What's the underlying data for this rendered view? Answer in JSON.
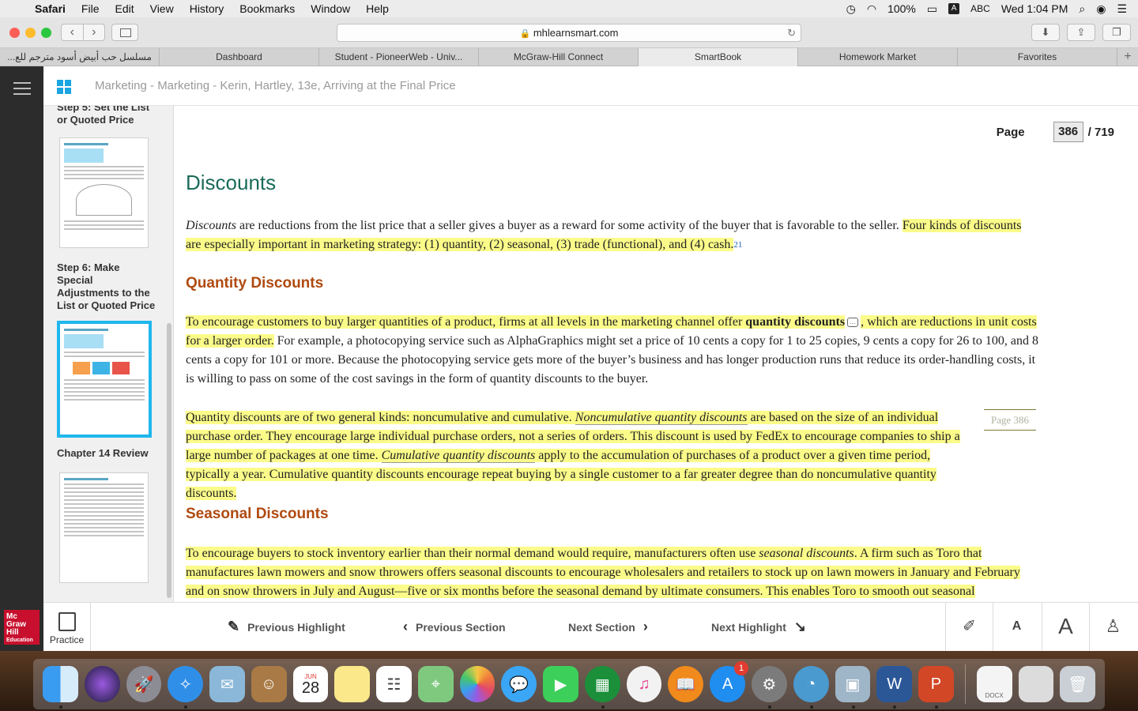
{
  "menubar": {
    "app": "Safari",
    "items": [
      "File",
      "Edit",
      "View",
      "History",
      "Bookmarks",
      "Window",
      "Help"
    ],
    "battery": "100%",
    "input_source": "ABC",
    "input_letter": "A",
    "clock": "Wed 1:04 PM"
  },
  "browser": {
    "url": "mhlearnsmart.com",
    "tabs": [
      {
        "label": "مسلسل حب أبيض أسود مترجم للع...",
        "active": false
      },
      {
        "label": "Dashboard",
        "active": false
      },
      {
        "label": "Student - PioneerWeb - Univ...",
        "active": false
      },
      {
        "label": "McGraw-Hill Connect",
        "active": false
      },
      {
        "label": "SmartBook",
        "active": true
      },
      {
        "label": "Homework Market",
        "active": false
      },
      {
        "label": "Favorites",
        "active": false
      }
    ]
  },
  "app": {
    "title": "Marketing - Marketing - Kerin, Hartley, 13e, Arriving at the Final Price",
    "logo_lines": [
      "Mc",
      "Graw",
      "Hill",
      "Education"
    ]
  },
  "sidebar": {
    "section_top": "Step 5: Set the List or Quoted Price",
    "section_step6": "Step 6: Make Special Adjustments to the List or Quoted Price",
    "section_review": "Chapter 14 Review"
  },
  "pager": {
    "label": "Page",
    "current": "386",
    "total": "/ 719"
  },
  "doc": {
    "heading": "Discounts",
    "intro_em": "Discounts",
    "intro_plain": " are reductions from the list price that a seller gives a buyer as a reward for some activity of the buyer that is favorable to the seller. ",
    "intro_hl": "Four kinds of discounts are especially important in marketing strategy: (1) quantity, (2) seasonal, (3) trade (functional), and (4) cash.",
    "intro_sup": "21",
    "h_quantity": "Quantity Discounts",
    "q1_hl_a": "To encourage customers to buy larger quantities of a product, firms at all levels in the marketing channel offer ",
    "q1_kw": "quantity discounts",
    "q1_hl_b": ", which are reductions in unit costs for a larger order.",
    "q1_plain": " For example, a photocopying service such as AlphaGraphics might set a price of 10 cents a copy for 1 to 25 copies, 9 cents a copy for 26 to 100, and 8 cents a copy for 101 or more. Because the photocopying service gets more of the buyer’s business and has longer production runs that reduce its order-handling costs, it is willing to pass on some of the cost savings in the form of quantity discounts to the buyer.",
    "q2_a": "Quantity discounts are of two general kinds: noncumulative and cumulative. ",
    "q2_em1": "Noncumulative quantity discounts",
    "q2_b": " are based on the size of an individual purchase order. They encourage large individual purchase orders, not a series of orders. This discount is used by FedEx to encourage companies to ship a large number of packages at one time. ",
    "q2_em2": "Cumulative quantity discounts",
    "q2_c": " apply to the accumulation of purchases of a product over a given time period, typically a year. Cumulative quantity discounts encourage repeat buying by a single customer to a far greater degree than do noncumulative quantity discounts.",
    "page_marker": "Page 386",
    "h_seasonal": "Seasonal Discounts",
    "s1_a": "To encourage buyers to stock inventory earlier than their normal demand would require, manufacturers often use ",
    "s1_em": "seasonal discounts",
    "s1_b": ". A firm such as Toro that manufactures lawn mowers and snow throwers offers seasonal discounts to encourage wholesalers and retailers to stock up on lawn mowers in January and February and on snow throwers in July and August—five or six months before the seasonal demand by ultimate consumers. This enables Toro to smooth out seasonal"
  },
  "bottombar": {
    "practice": "Practice",
    "prev_highlight": "Previous Highlight",
    "prev_section": "Previous Section",
    "next_section": "Next Section",
    "next_highlight": "Next Highlight",
    "font_small": "A",
    "font_large": "A"
  },
  "dock": {
    "calendar_month": "JUN",
    "calendar_day": "28",
    "appstore_badge": "1",
    "docx_label": "DOCX"
  }
}
